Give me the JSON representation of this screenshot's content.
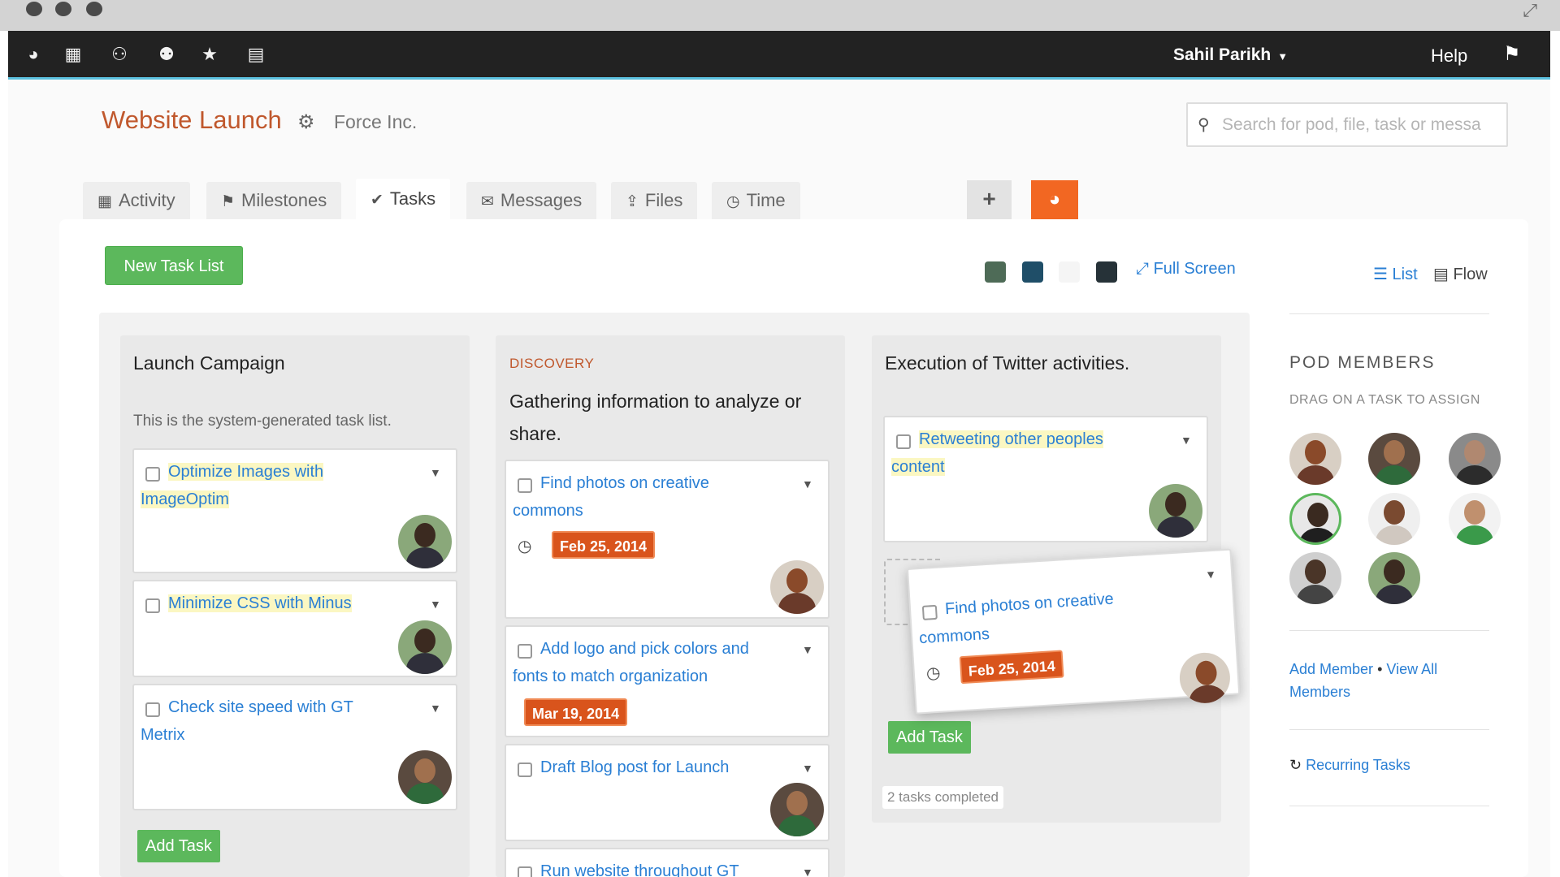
{
  "window": {
    "controls": [
      "close",
      "minimize",
      "zoom"
    ],
    "expand_icon": "expand-arrows-icon"
  },
  "nav": {
    "icons": [
      "logo-icon",
      "film-icon",
      "group-icon",
      "user-icon",
      "star-icon",
      "calendar-icon"
    ],
    "user_name": "Sahil Parikh",
    "help": "Help"
  },
  "project": {
    "title": "Website Launch",
    "company": "Force Inc."
  },
  "search": {
    "placeholder": "Search for pod, file, task or messa"
  },
  "tabs": [
    {
      "label": "Activity"
    },
    {
      "label": "Milestones"
    },
    {
      "label": "Tasks"
    },
    {
      "label": "Messages"
    },
    {
      "label": "Files"
    },
    {
      "label": "Time"
    }
  ],
  "active_tab": "Tasks",
  "toolbar": {
    "new_task_list": "New Task List",
    "full_screen": "Full Screen",
    "view_list": "List",
    "view_flow": "Flow",
    "swatches": [
      "#4e6b57",
      "#1f4e68",
      "#f5f5f5",
      "#263238"
    ]
  },
  "columns": [
    {
      "title": "Launch Campaign",
      "subtitle": "This is the system-generated task list.",
      "tasks": [
        {
          "text_1": "Optimize Images with",
          "text_2": "ImageOptim"
        },
        {
          "text_1": "Minimize CSS with Minus"
        },
        {
          "text_1": "Check site speed with GT",
          "text_2": "Metrix"
        }
      ],
      "add_task": "Add Task"
    },
    {
      "label": "DISCOVERY",
      "title_1": "Gathering information to analyze or",
      "title_2": "share.",
      "tasks": [
        {
          "text_1": "Find photos on creative",
          "text_2": "commons",
          "due": "Feb 25, 2014"
        },
        {
          "text_1": "Add logo and pick colors and",
          "text_2": "fonts to match organization",
          "due": "Mar 19, 2014"
        },
        {
          "text_1": "Draft Blog post for Launch"
        },
        {
          "text_1": "Run website throughout GT"
        }
      ]
    },
    {
      "title": "Execution of Twitter activities.",
      "tasks": [
        {
          "text_1": "Retweeting other peoples",
          "text_2": "content"
        }
      ],
      "dragging_task": {
        "text_1": "Find photos on creative",
        "text_2": "commons",
        "due": "Feb 25, 2014"
      },
      "add_task": "Add Task",
      "completed": "2 tasks completed"
    }
  ],
  "pod": {
    "title": "POD MEMBERS",
    "subtitle": "DRAG ON A TASK TO ASSIGN",
    "add_member": "Add Member",
    "separator": "•",
    "view_all": "View All Members",
    "recurring": "Recurring Tasks"
  }
}
